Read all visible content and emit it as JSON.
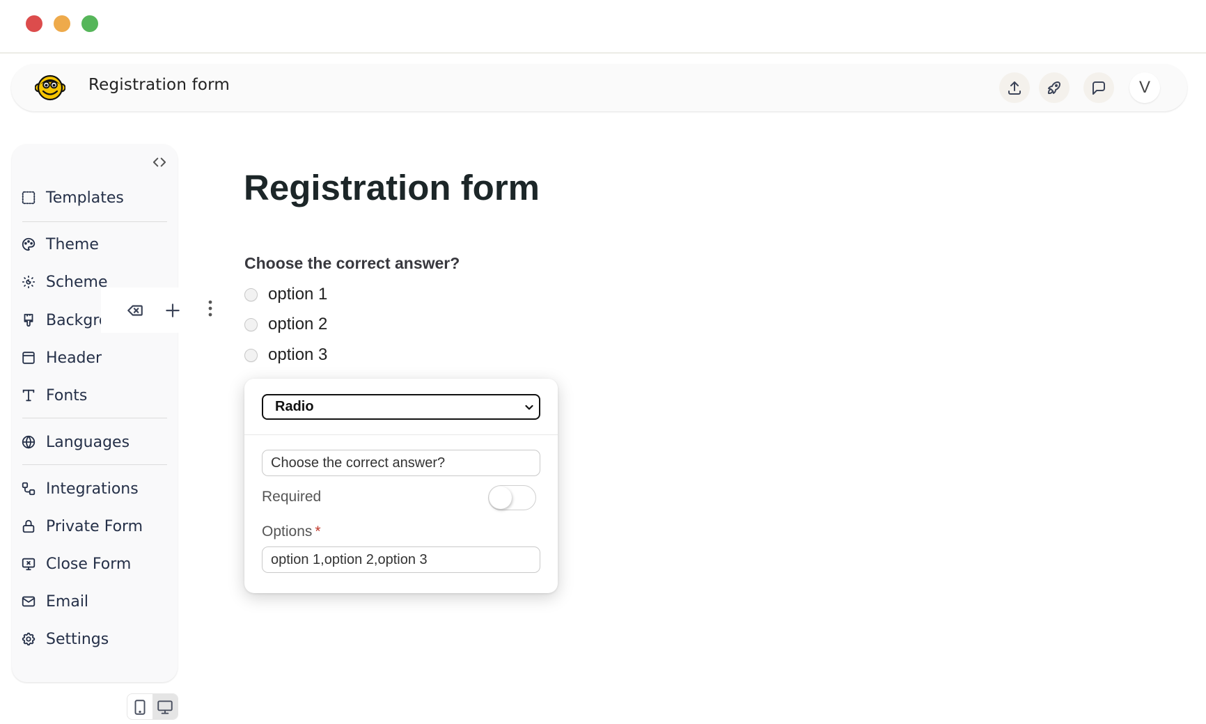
{
  "window": {
    "controls": [
      "close",
      "minimize",
      "maximize"
    ]
  },
  "topbar": {
    "logo_icon": "monkey-face-icon",
    "title": "Registration form",
    "actions": [
      {
        "name": "publish",
        "icon": "upload-icon"
      },
      {
        "name": "launch",
        "icon": "rocket-icon"
      },
      {
        "name": "comments",
        "icon": "comment-icon"
      }
    ],
    "avatar_initial": "V"
  },
  "sidebar": {
    "collapse_icon": "code-brackets-icon",
    "items": [
      {
        "label": "Templates",
        "icon": "templates-icon"
      },
      {
        "label": "Theme",
        "icon": "palette-icon"
      },
      {
        "label": "Scheme",
        "icon": "sun-moon-icon"
      },
      {
        "label": "Background",
        "icon": "paintbrush-icon"
      },
      {
        "label": "Header",
        "icon": "layout-header-icon"
      },
      {
        "label": "Fonts",
        "icon": "typography-icon"
      },
      {
        "label": "Languages",
        "icon": "globe-icon"
      },
      {
        "label": "Integrations",
        "icon": "integrations-icon"
      },
      {
        "label": "Private Form",
        "icon": "lock-icon"
      },
      {
        "label": "Close Form",
        "icon": "monitor-x-icon"
      },
      {
        "label": "Email",
        "icon": "mail-icon"
      },
      {
        "label": "Settings",
        "icon": "gear-icon"
      }
    ]
  },
  "field_toolbar": {
    "delete_icon": "backspace-icon",
    "add_icon": "plus-icon",
    "more_icon": "vertical-dots-icon"
  },
  "device_toggle": {
    "options": [
      "mobile",
      "desktop"
    ],
    "active": "desktop"
  },
  "form": {
    "title": "Registration form",
    "question": {
      "label": "Choose the correct answer?",
      "options": [
        "option 1",
        "option 2",
        "option 3"
      ]
    }
  },
  "editor": {
    "field_type": "Radio",
    "question_value": "Choose the correct answer?",
    "required_label": "Required",
    "required": false,
    "options_label": "Options",
    "options_required_marker": "*",
    "options_value": "option 1,option 2,option 3"
  }
}
